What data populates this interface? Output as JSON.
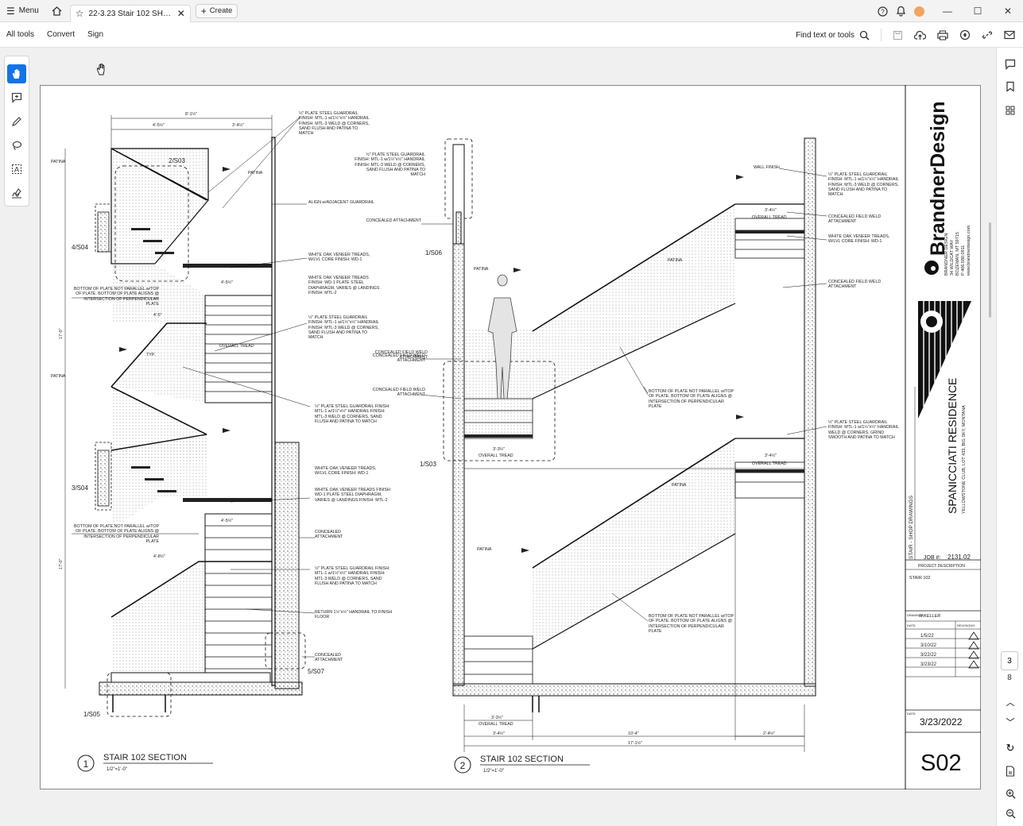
{
  "titlebar": {
    "menu_label": "Menu",
    "tab_title": "22-3.23 Stair 102 SHOPS...",
    "create_label": "Create"
  },
  "toolbar": {
    "all_tools": "All tools",
    "convert": "Convert",
    "sign": "Sign",
    "find_label": "Find text or tools"
  },
  "page_nav": {
    "current": "3",
    "total": "8"
  },
  "titleblock": {
    "company": "BrandnerDesign",
    "address": [
      "BRANDNER DESIGN",
      "34 WILDCAT WAY",
      "BOZEMAN, MT 59715",
      "P 406.580.0911",
      "www.brandnerdesign.com"
    ],
    "project": "SPANICCIATI RESIDENCE",
    "project_sub": "YELLOWSTONE CLUB, LOT 433, BIG SKY, MONTANA",
    "sheet_set": "STAIR - SHOP DRAWINGS",
    "job_label": "JOB #:",
    "job_number": "2131.02",
    "project_desc_label": "PROJECT DESCRIPTION",
    "project_desc": "STAIR 102",
    "drawn_by_label": "DRAWN BY:",
    "drawn_by": "M.KELLER",
    "date_col": "DATE:",
    "rev_col": "REVISIONS:",
    "rev_dates": [
      "1/5/22",
      "3/10/22",
      "3/22/22",
      "3/23/22"
    ],
    "date_label": "DATE:",
    "date": "3/23/2022",
    "sheet_number": "S02"
  },
  "section1": {
    "number": "1",
    "title": "STAIR 102 SECTION",
    "scale": "1/2\"=1'-0\"",
    "refs": [
      "2/S03",
      "4/S04",
      "3/S04",
      "1/S05",
      "5/S07"
    ],
    "dims": [
      "8'-1½\"",
      "4'-5½\"",
      "3'-4½\"",
      "17'-0\"",
      "17'-0\"",
      "4'-5½\"",
      "4'-5\"",
      "4'-5½\"",
      "4'-8½\""
    ],
    "notes": [
      "½\" PLATE STEEL GUARDRAIL FINISH: MTL-1 w/1½\"x½\" HANDRAIL FINISH: MTL-3 WELD @ CORNERS, SAND FLUSH AND PATINA TO MATCH",
      "ALIGN w/ADJACENT GUARDRAIL",
      "WHITE OAK VENEER TREADS, W/LVL CORE FINISH: WD-1",
      "WHITE OAK VENEER TREADS FINISH: WD-1 PLATE STEEL DIAPHRAGM, VARIES @ LANDINGS FINISH: MTL-2",
      "BOTTOM OF PLATE NOT PARALLEL w/TOP OF PLATE. BOTTOM OF PLATE ALIGNS @ INTERSECTION OF PERPENDICULAR PLATE",
      "CONCEALED FIELD WELD ATTACHMENT",
      "CONCEALED ATTACHMENT",
      "RETURN 1½\"x½\" HANDRAIL TO FINISH FLOOR",
      "OVERALL TREAD",
      "PATINA",
      "TYP."
    ]
  },
  "section2": {
    "number": "2",
    "title": "STAIR 102 SECTION",
    "scale": "1/2\"=1'-0\"",
    "refs": [
      "1/S06",
      "1/S03"
    ],
    "dims": [
      "3'-3½\"",
      "10'-4\"",
      "2'-4½\"",
      "17'-1½\"",
      "3'-3½\"",
      "3'-4½\""
    ],
    "notes": [
      "WALL FINISH",
      "CONCEALED ATTACHMENT",
      "CONCEALED FIELD WELD ATTACHMENT",
      "½\" PLATE STEEL GUARDRAIL FINISH: MTL-1 w/1½\"x½\" HANDRAIL FINISH: MTL-3 WELD @ CORNERS, SAND FLUSH AND PATINA TO MATCH",
      "½\" PLATE STEEL GUARDRAIL FINISH: MTL-1 w/1½\"x½\" HANDRAIL WELD @ CORNERS, GRIND SMOOTH AND PATINA TO MATCH",
      "WHITE OAK VENEER TREADS, W/LVL CORE FINISH: WD-1",
      "BOTTOM OF PLATE NOT PARALLEL w/TOP OF PLATE. BOTTOM OF PLATE ALIGNS @ INTERSECTION OF PERPENDICULAR PLATE",
      "OVERALL TREAD",
      "PATINA"
    ]
  }
}
